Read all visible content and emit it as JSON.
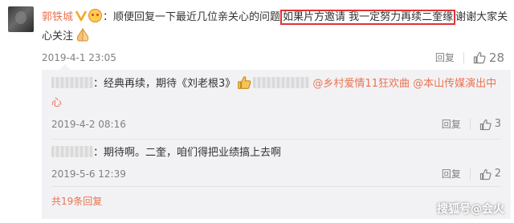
{
  "main_comment": {
    "username": "郭铁城",
    "text_before_highlight": "：顺便回复一下最近几位亲关心的问题",
    "highlighted_text": "如果片方邀请 我一定努力再续二奎缘",
    "text_after_highlight": "谢谢大家关心关注",
    "date": "2019-4-1 23:05",
    "reply_label": "回复",
    "like_count": "28"
  },
  "replies": [
    {
      "text": "：经典再续，期待《刘老根3》",
      "mentions": "@乡村爱情11狂欢曲 @本山传媒演出中心",
      "date": "2019-4-2 08:16",
      "reply_label": "回复",
      "like_count": "3"
    },
    {
      "text": "：期待啊。二奎，咱们得把业绩搞上去啊",
      "date": "2019-5-6 12:39",
      "reply_label": "回复",
      "like_count": "2"
    }
  ],
  "more_replies_label": "共19条回复",
  "watermark": "搜狐号@会火",
  "colors": {
    "accent": "#eb7350",
    "highlight_border": "#e03236",
    "reply_bg": "#f2f2f5",
    "meta_text": "#808080"
  }
}
